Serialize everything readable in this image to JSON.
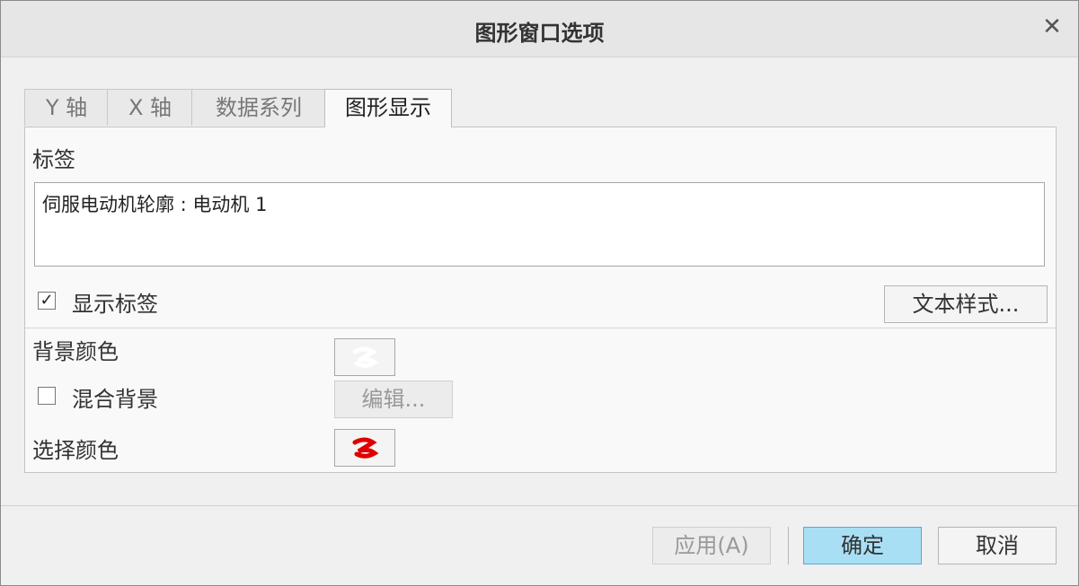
{
  "window": {
    "title": "图形窗口选项"
  },
  "tabs": [
    {
      "label": "Y 轴",
      "active": false
    },
    {
      "label": "X 轴",
      "active": false
    },
    {
      "label": "数据系列",
      "active": false
    },
    {
      "label": "图形显示",
      "active": true
    }
  ],
  "panel": {
    "label_heading": "标签",
    "label_value": "伺服电动机轮廓 : 电动机 1",
    "show_label": {
      "text": "显示标签",
      "checked": true
    },
    "text_style_button": "文本样式...",
    "background_color_label": "背景颜色",
    "blend_background": {
      "text": "混合背景",
      "checked": false
    },
    "edit_button": "编辑...",
    "select_color_label": "选择颜色"
  },
  "colors": {
    "accent_button": "#a9dff5",
    "selection_swatch": "#e00000",
    "background_swatch": "#ffffff"
  },
  "footer": {
    "apply": "应用(A)",
    "ok": "确定",
    "cancel": "取消"
  }
}
